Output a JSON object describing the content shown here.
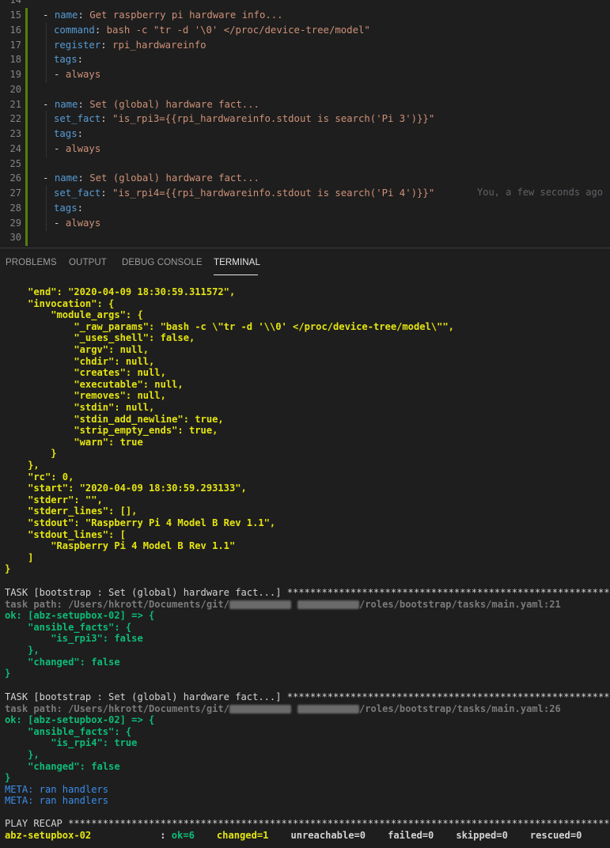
{
  "editor": {
    "line_numbers": [
      "14",
      "15",
      "16",
      "17",
      "18",
      "19",
      "20",
      "21",
      "22",
      "23",
      "24",
      "25",
      "26",
      "27",
      "28",
      "29",
      "30"
    ],
    "lines": [
      {
        "dash": "",
        "key": "",
        "value": ""
      },
      {
        "dash": "- ",
        "key": "name",
        "value": " Get raspberry pi hardware info..."
      },
      {
        "dash": "",
        "key": "command",
        "value": " bash -c \"tr -d '\\0' </proc/device-tree/model\""
      },
      {
        "dash": "",
        "key": "register",
        "value": " rpi_hardwareinfo"
      },
      {
        "dash": "",
        "key": "tags",
        "value": ""
      },
      {
        "dash": "- ",
        "key": "",
        "value": "always"
      },
      {
        "dash": "",
        "key": "",
        "value": ""
      },
      {
        "dash": "- ",
        "key": "name",
        "value": " Set (global) hardware fact..."
      },
      {
        "dash": "",
        "key": "set_fact",
        "value": " \"is_rpi3={{rpi_hardwareinfo.stdout is search('Pi 3')}}\""
      },
      {
        "dash": "",
        "key": "tags",
        "value": ""
      },
      {
        "dash": "- ",
        "key": "",
        "value": "always"
      },
      {
        "dash": "",
        "key": "",
        "value": ""
      },
      {
        "dash": "- ",
        "key": "name",
        "value": " Set (global) hardware fact..."
      },
      {
        "dash": "",
        "key": "set_fact",
        "value": " \"is_rpi4={{rpi_hardwareinfo.stdout is search('Pi 4')}}\""
      },
      {
        "dash": "",
        "key": "tags",
        "value": ""
      },
      {
        "dash": "- ",
        "key": "",
        "value": "always"
      },
      {
        "dash": "",
        "key": "",
        "value": ""
      }
    ],
    "blame": "You, a few seconds ago"
  },
  "panel": {
    "tabs": [
      "PROBLEMS",
      "OUTPUT",
      "DEBUG CONSOLE",
      "TERMINAL"
    ],
    "active_tab": "TERMINAL"
  },
  "terminal": {
    "json_lines": [
      "    \"end\": \"2020-04-09 18:30:59.311572\",",
      "    \"invocation\": {",
      "        \"module_args\": {",
      "            \"_raw_params\": \"bash -c \\\"tr -d '\\\\0' </proc/device-tree/model\\\"\",",
      "            \"_uses_shell\": false,",
      "            \"argv\": null,",
      "            \"chdir\": null,",
      "            \"creates\": null,",
      "            \"executable\": null,",
      "            \"removes\": null,",
      "            \"stdin\": null,",
      "            \"stdin_add_newline\": true,",
      "            \"strip_empty_ends\": true,",
      "            \"warn\": true",
      "        }",
      "    },",
      "    \"rc\": 0,",
      "    \"start\": \"2020-04-09 18:30:59.293133\",",
      "    \"stderr\": \"\",",
      "    \"stderr_lines\": [],",
      "    \"stdout\": \"Raspberry Pi 4 Model B Rev 1.1\",",
      "    \"stdout_lines\": [",
      "        \"Raspberry Pi 4 Model B Rev 1.1\"",
      "    ]",
      "}"
    ],
    "task1": {
      "header": "TASK [bootstrap : Set (global) hardware fact...] ",
      "stars": "****************************************************************************",
      "path_prefix": "task path: /Users/hkrott/Documents/git/",
      "path_suffix": "/roles/bootstrap/tasks/main.yaml:21",
      "ok_line": "ok: [abz-setupbox-02] => {",
      "body": [
        "    \"ansible_facts\": {",
        "        \"is_rpi3\": false",
        "    },",
        "    \"changed\": false",
        "}"
      ]
    },
    "task2": {
      "header": "TASK [bootstrap : Set (global) hardware fact...] ",
      "stars": "****************************************************************************",
      "path_prefix": "task path: /Users/hkrott/Documents/git/",
      "path_suffix": "/roles/bootstrap/tasks/main.yaml:26",
      "ok_line": "ok: [abz-setupbox-02] => {",
      "body": [
        "    \"ansible_facts\": {",
        "        \"is_rpi4\": true",
        "    },",
        "    \"changed\": false",
        "}"
      ]
    },
    "meta_lines": [
      "META: ran handlers",
      "META: ran handlers"
    ],
    "recap": {
      "header": "PLAY RECAP ",
      "stars": "**************************************************************************************************",
      "host": "abz-setupbox-02",
      "sep": ": ",
      "ok": "ok=6",
      "changed": "changed=1",
      "unreachable": "unreachable=0",
      "failed": "failed=0",
      "skipped": "skipped=0",
      "rescued": "rescued=0"
    }
  },
  "colors": {
    "background": "#1e1e1e",
    "yaml_key": "#569cd6",
    "yaml_string": "#ce9178",
    "terminal_yellow": "#e5e510",
    "terminal_green": "#0dbc79",
    "terminal_blue": "#3b8eea",
    "git_added": "#587c0c"
  }
}
